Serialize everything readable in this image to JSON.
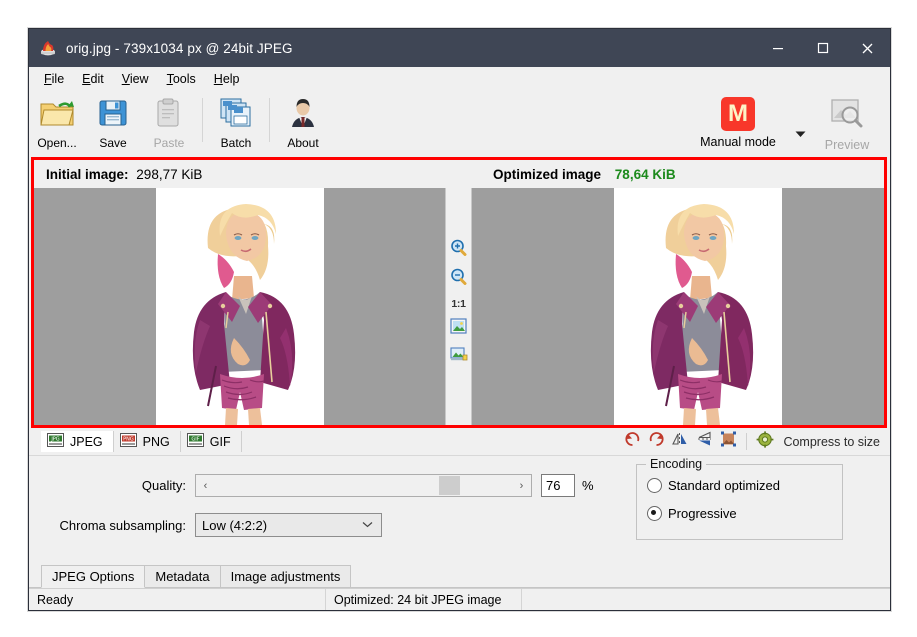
{
  "window": {
    "title": "orig.jpg - 739x1034 px @ 24bit JPEG",
    "icon": "app-flame-icon",
    "minimize": "–",
    "maximize": "□",
    "close": "✕"
  },
  "menubar": [
    {
      "label": "File",
      "accel": "F"
    },
    {
      "label": "Edit",
      "accel": "E"
    },
    {
      "label": "View",
      "accel": "V"
    },
    {
      "label": "Tools",
      "accel": "T"
    },
    {
      "label": "Help",
      "accel": "H"
    }
  ],
  "toolbar": {
    "buttons": [
      {
        "label": "Open...",
        "icon": "open-folder-icon",
        "enabled": true
      },
      {
        "label": "Save",
        "icon": "save-floppy-icon",
        "enabled": true
      },
      {
        "label": "Paste",
        "icon": "paste-clipboard-icon",
        "enabled": false
      },
      {
        "label": "Batch",
        "icon": "batch-files-icon",
        "enabled": true
      },
      {
        "label": "About",
        "icon": "about-person-icon",
        "enabled": true
      }
    ],
    "mode": {
      "badge": "M",
      "label": "Manual mode",
      "badge_color": "#f8372a",
      "caret": "▼"
    },
    "preview": {
      "label": "Preview",
      "icon": "preview-magnifier-icon",
      "enabled": false
    }
  },
  "compare": {
    "highlight_color": "#ff0000",
    "initial": {
      "label": "Initial image:",
      "value": "298,77 KiB"
    },
    "optimized": {
      "label": "Optimized image",
      "value": "78,64 KiB",
      "value_color": "#1c8a1c"
    },
    "mid_tools": [
      {
        "name": "zoom-in-icon",
        "label": ""
      },
      {
        "name": "zoom-out-icon",
        "label": ""
      },
      {
        "name": "zoom-actual-size",
        "label": "1:1"
      },
      {
        "name": "fit-image-icon",
        "label": ""
      },
      {
        "name": "fit-window-icon",
        "label": ""
      }
    ]
  },
  "formats": {
    "tabs": [
      {
        "label": "JPEG",
        "badge": "JPG",
        "badge_color": "#2f7a2f",
        "active": true
      },
      {
        "label": "PNG",
        "badge": "PNG",
        "badge_color": "#c0392b",
        "active": false
      },
      {
        "label": "GIF",
        "badge": "GIF",
        "badge_color": "#2f7a2f",
        "active": false
      }
    ],
    "tools": [
      {
        "name": "rotate-left-icon"
      },
      {
        "name": "rotate-right-icon"
      },
      {
        "name": "flip-horizontal-icon"
      },
      {
        "name": "flip-vertical-icon"
      },
      {
        "name": "resize-canvas-icon"
      }
    ],
    "compress_to_size": {
      "label": "Compress to size",
      "icon": "gear-icon"
    }
  },
  "options": {
    "quality": {
      "label": "Quality:",
      "value": "76",
      "unit": "%",
      "left_arrow": "‹",
      "right_arrow": "›"
    },
    "chroma": {
      "label": "Chroma subsampling:",
      "value": "Low (4:2:2)",
      "caret": "⌄"
    },
    "encoding": {
      "title": "Encoding",
      "options": [
        {
          "label": "Standard optimized",
          "selected": false
        },
        {
          "label": "Progressive",
          "selected": true
        }
      ]
    }
  },
  "bottom_tabs": [
    {
      "label": "JPEG Options",
      "active": true
    },
    {
      "label": "Metadata",
      "active": false
    },
    {
      "label": "Image adjustments",
      "active": false
    }
  ],
  "statusbar": {
    "left": "Ready",
    "center": "Optimized: 24 bit JPEG image",
    "right": ""
  }
}
